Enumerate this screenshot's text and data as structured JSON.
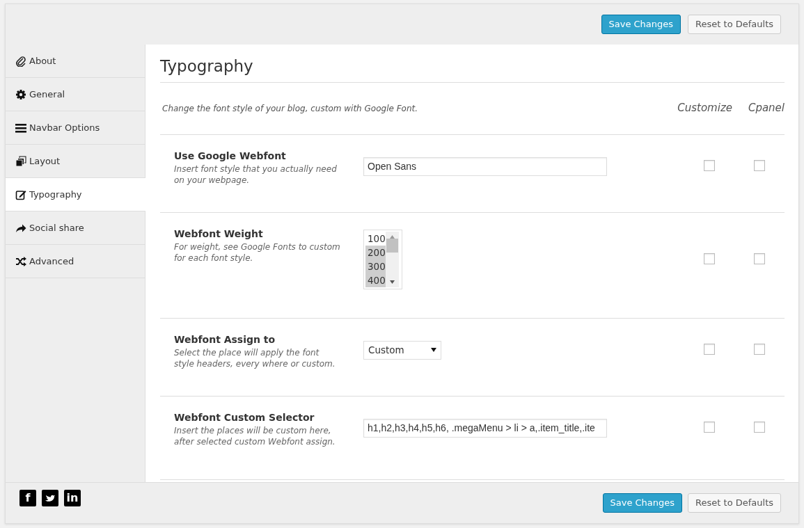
{
  "header_buttons": [
    {
      "label": "Save Changes",
      "kind": "primary"
    },
    {
      "label": "Reset to Defaults",
      "kind": "secondary"
    }
  ],
  "sidebar": {
    "items": [
      {
        "label": "About",
        "selected": false
      },
      {
        "label": "General",
        "selected": false
      },
      {
        "label": "Navbar Options",
        "selected": false
      },
      {
        "label": "Layout",
        "selected": false
      },
      {
        "label": "Typography",
        "selected": true
      },
      {
        "label": "Social share",
        "selected": false
      },
      {
        "label": "Advanced",
        "selected": false
      }
    ]
  },
  "section": {
    "title": "Typography",
    "intro": "Change the font style of your blog, custom with Google Font.",
    "columns": [
      "Customize",
      "Cpanel"
    ]
  },
  "fields": [
    {
      "kind": "text",
      "label": "Use Google Webfont",
      "description": "Insert font style that you actually need on your webpage.",
      "value": "Open Sans",
      "customize": false,
      "cpanel": false
    },
    {
      "kind": "listbox",
      "label": "Webfont Weight",
      "description": "For weight, see Google Fonts to custom for each font style.",
      "options": [
        {
          "label": "100",
          "selected": false
        },
        {
          "label": "200",
          "selected": true
        },
        {
          "label": "300",
          "selected": true
        },
        {
          "label": "400",
          "selected": true
        }
      ],
      "customize": false,
      "cpanel": false
    },
    {
      "kind": "select",
      "label": "Webfont Assign to",
      "description": "Select the place will apply the font style headers, every where or custom.",
      "value": "Custom",
      "customize": false,
      "cpanel": false
    },
    {
      "kind": "text",
      "label": "Webfont Custom Selector",
      "description": "Insert the places will be custom here, after selected custom Webfont assign.",
      "value": "h1,h2,h3,h4,h5,h6, .megaMenu > li > a,.item_title,.ite",
      "customize": false,
      "cpanel": false
    }
  ],
  "footer": {
    "social": [
      {
        "kind": "facebook",
        "glyph": "f"
      },
      {
        "kind": "twitter"
      },
      {
        "kind": "linkedin",
        "glyph": "in"
      }
    ],
    "buttons": [
      {
        "label": "Save Changes",
        "kind": "primary"
      },
      {
        "label": "Reset to Defaults",
        "kind": "secondary"
      }
    ]
  }
}
